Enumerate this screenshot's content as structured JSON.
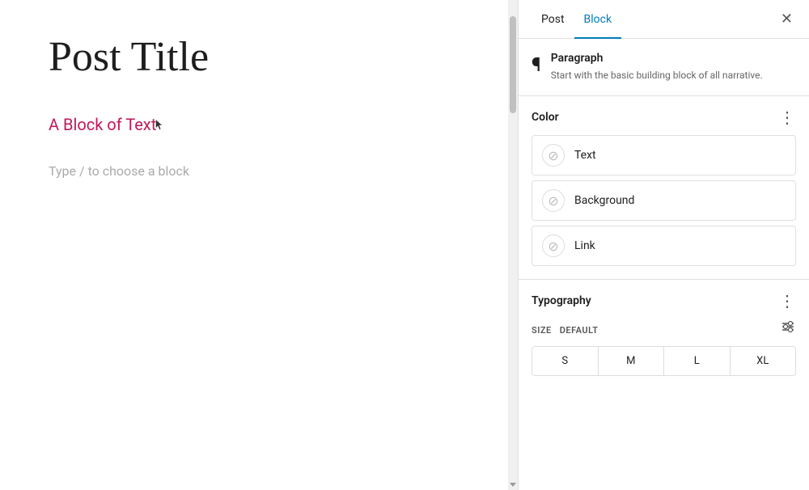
{
  "editor": {
    "post_title": "Post Title",
    "block_text": "A Block of Text",
    "placeholder": "Type / to choose a block"
  },
  "panel": {
    "tab_post": "Post",
    "tab_block": "Block",
    "close_label": "✕",
    "block_info": {
      "icon": "¶",
      "title": "Paragraph",
      "description": "Start with the basic building block of all narrative."
    },
    "color_section": {
      "title": "Color",
      "more_icon": "⋮",
      "options": [
        {
          "label": "Text",
          "swatch": "⊘"
        },
        {
          "label": "Background",
          "swatch": "⊘"
        },
        {
          "label": "Link",
          "swatch": "⊘"
        }
      ]
    },
    "typography_section": {
      "title": "Typography",
      "more_icon": "⋮",
      "size_label": "SIZE",
      "size_value": "DEFAULT",
      "sizes": [
        "S",
        "M",
        "L",
        "XL"
      ]
    }
  }
}
